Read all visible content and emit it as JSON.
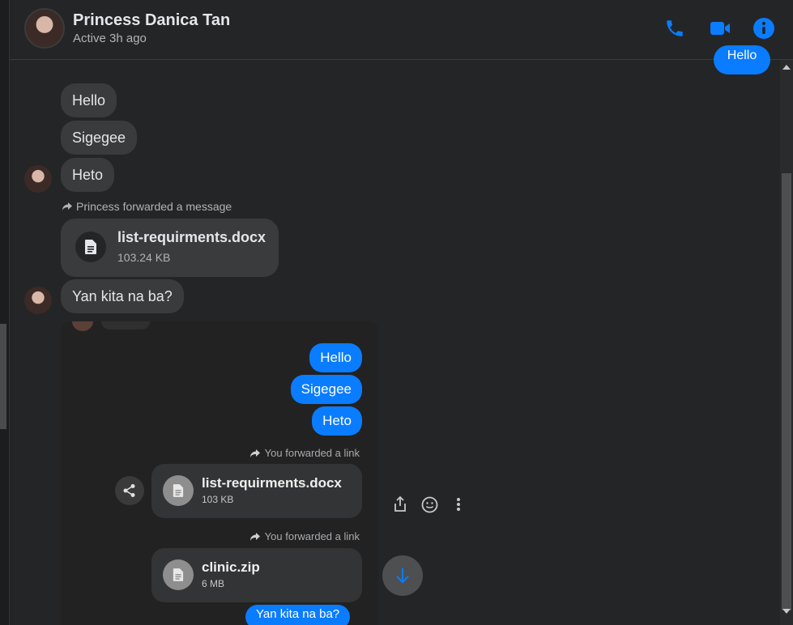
{
  "colors": {
    "accent": "#0a7cff",
    "bg": "#242526",
    "bubble_in": "#3a3b3c"
  },
  "header": {
    "name": "Princess Danica Tan",
    "status": "Active 3h ago",
    "icons": [
      "phone-icon",
      "video-icon",
      "info-icon"
    ]
  },
  "messages": {
    "top_outgoing": "Hello",
    "incoming": [
      "Hello",
      "Sigegee",
      "Heto"
    ],
    "forward_label": "Princess forwarded a message",
    "file": {
      "name": "list-requirments.docx",
      "size": "103.24 KB"
    },
    "last_incoming": "Yan kita na ba?"
  },
  "screenshot": {
    "outgoing": [
      "Hello",
      "Sigegee",
      "Heto"
    ],
    "fwd1": "You forwarded a link",
    "file1": {
      "name": "list-requirments.docx",
      "size": "103 KB"
    },
    "fwd2": "You forwarded a link",
    "file2": {
      "name": "clinic.zip",
      "size": "6 MB"
    },
    "partial_text": "Yan kita na ba?"
  },
  "actions": [
    "share-icon",
    "emoji-icon",
    "more-icon"
  ]
}
